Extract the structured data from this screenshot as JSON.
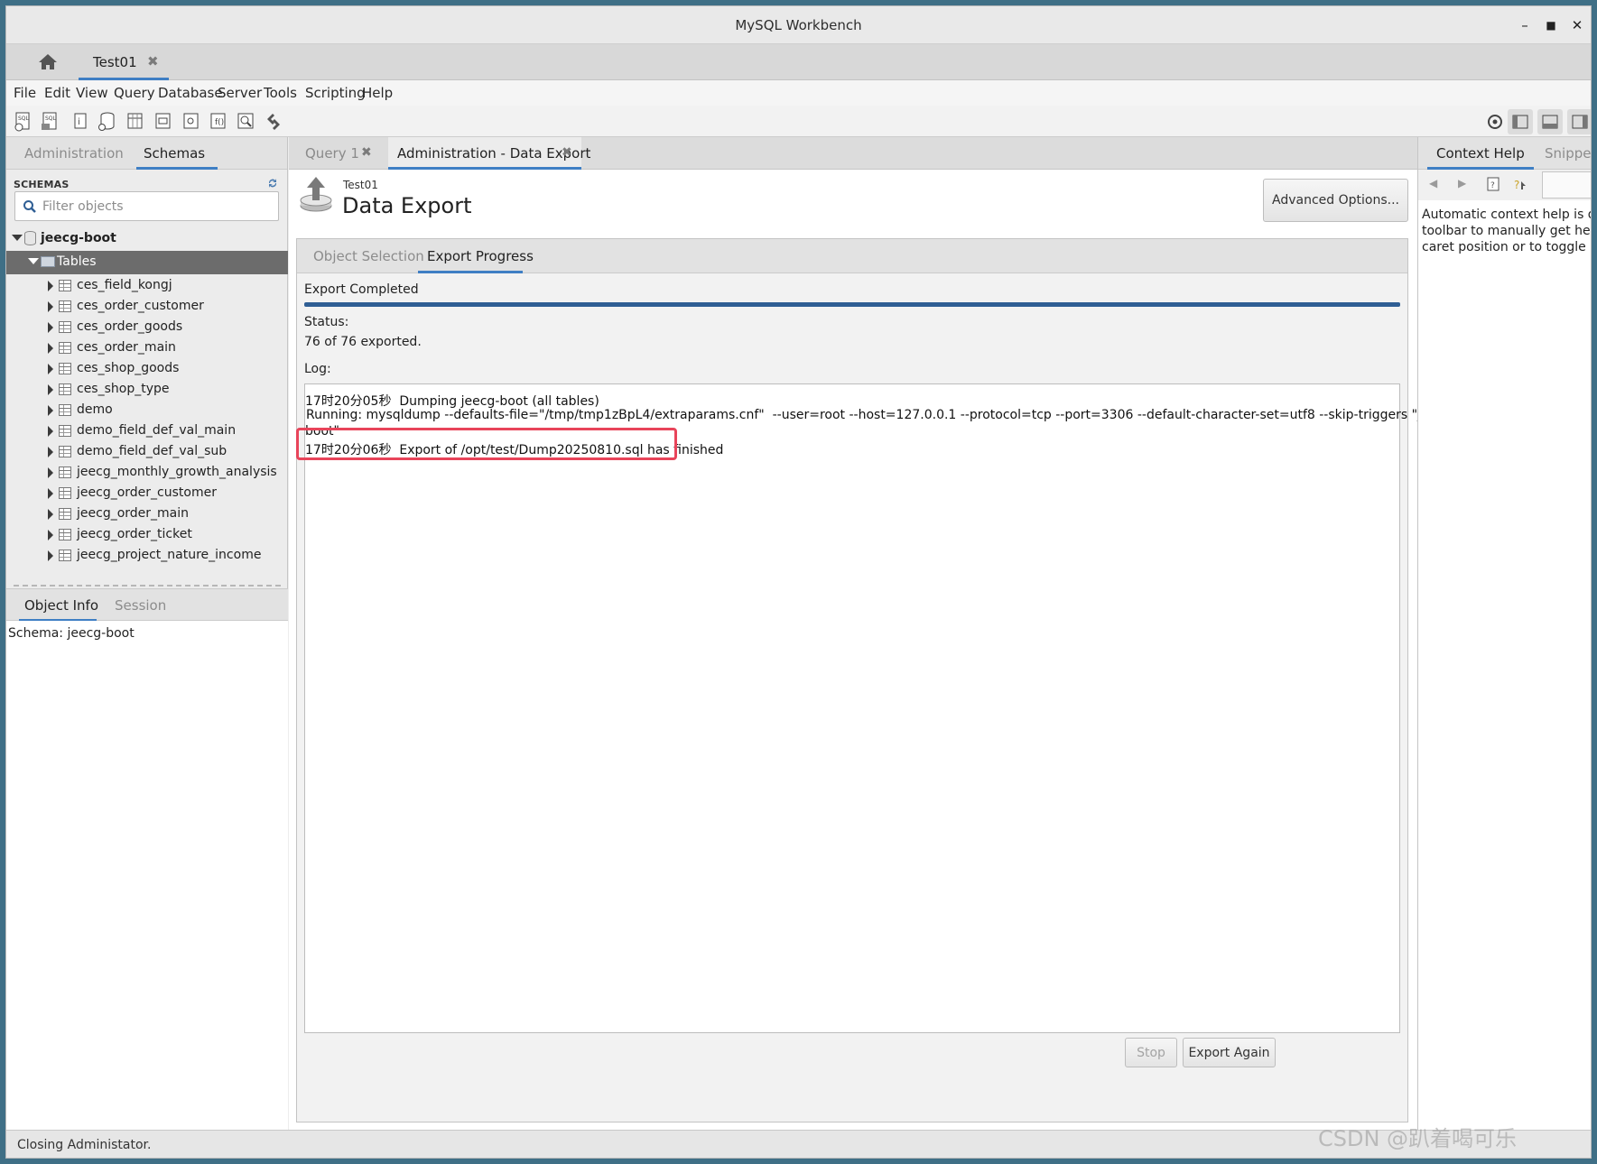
{
  "window": {
    "title": "MySQL Workbench"
  },
  "connection_tab": {
    "label": "Test01"
  },
  "menu": [
    "File",
    "Edit",
    "View",
    "Query",
    "Database",
    "Server",
    "Tools",
    "Scripting",
    "Help"
  ],
  "sidebar": {
    "tabs": [
      "Administration",
      "Schemas"
    ],
    "schemas_header": "SCHEMAS",
    "filter_placeholder": "Filter objects",
    "schema": "jeecg-boot",
    "tables_node": "Tables",
    "tables": [
      "ces_field_kongj",
      "ces_order_customer",
      "ces_order_goods",
      "ces_order_main",
      "ces_shop_goods",
      "ces_shop_type",
      "demo",
      "demo_field_def_val_main",
      "demo_field_def_val_sub",
      "jeecg_monthly_growth_analysis",
      "jeecg_order_customer",
      "jeecg_order_main",
      "jeecg_order_ticket",
      "jeecg_project_nature_income"
    ],
    "info_tabs": [
      "Object Info",
      "Session"
    ],
    "object_info": "Schema: jeecg-boot"
  },
  "doc_tabs": [
    {
      "label": "Query 1"
    },
    {
      "label": "Administration - Data Export"
    }
  ],
  "export": {
    "connection": "Test01",
    "title": "Data Export",
    "advanced_button": "Advanced Options...",
    "tabs": [
      "Object Selection",
      "Export Progress"
    ],
    "completed_text": "Export Completed",
    "progress": 1.0,
    "status_label": "Status:",
    "status_value": "76 of 76 exported.",
    "log_label": "Log:",
    "log": [
      "17时20分05秒  Dumping jeecg-boot (all tables)",
      "Running: mysqldump --defaults-file=\"/tmp/tmp1zBpL4/extraparams.cnf\"  --user=root --host=127.0.0.1 --protocol=tcp --port=3306 --default-character-set=utf8 --skip-triggers \"jeecg-",
      "boot\"",
      "17时20分06秒  Export of /opt/test/Dump20250810.sql has finished"
    ],
    "stop_button": "Stop",
    "export_again_button": "Export Again"
  },
  "right_panel": {
    "tabs": [
      "Context Help",
      "Snippets"
    ],
    "help_lines": [
      "Automatic context help is disab",
      "toolbar to manually get help fo",
      "caret position or to toggle auto"
    ]
  },
  "status_bar": {
    "text": "Closing Administator."
  },
  "watermark": "CSDN @趴着喝可乐",
  "colors": {
    "accent": "#3f7fc4",
    "highlight": "#e8445a",
    "progress": "#2f5e94"
  }
}
